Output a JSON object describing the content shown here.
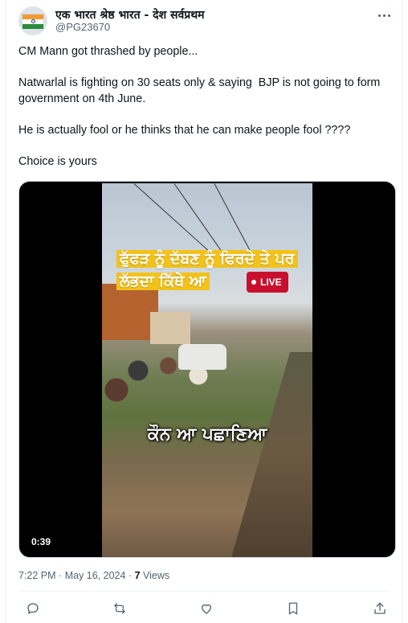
{
  "author": {
    "display_name": "एक भारत श्रेष्ठ भारत - देश सर्वप्रथम",
    "handle": "@PG23670",
    "avatar_icon": "india-flag-icon"
  },
  "tweet": {
    "paragraphs": [
      "CM Mann got thrashed by people...",
      "Natwarlal is fighting on 30 seats only & saying  BJP is not going to form government on 4th June.",
      "He is actually fool or he thinks that he can make people fool ????",
      "Choice is yours"
    ]
  },
  "media": {
    "caption_top": "ਫੁੱਫੜ ਨੂੰ ਦੱਬਣ ਨੂੰ ਫਿਰਦੇ ਤੇ ਪਰ ਲੱਭਦਾ ਕਿੱਥੇ ਆ",
    "live_label": "LIVE",
    "caption_bottom": "ਕੌਨ ਆ ਪਛਾਣਿਆ",
    "duration": "0:39"
  },
  "meta": {
    "time": "7:22 PM",
    "separator": "·",
    "date": "May 16, 2024",
    "views_count": "7",
    "views_label": "Views"
  },
  "actions": [
    {
      "name": "reply-icon"
    },
    {
      "name": "retweet-icon"
    },
    {
      "name": "like-icon"
    },
    {
      "name": "bookmark-icon"
    },
    {
      "name": "share-icon"
    }
  ],
  "colors": {
    "text_primary": "#0f1419",
    "text_secondary": "#536471",
    "caption_highlight": "#f3c21a",
    "live_badge": "#c8102e"
  }
}
